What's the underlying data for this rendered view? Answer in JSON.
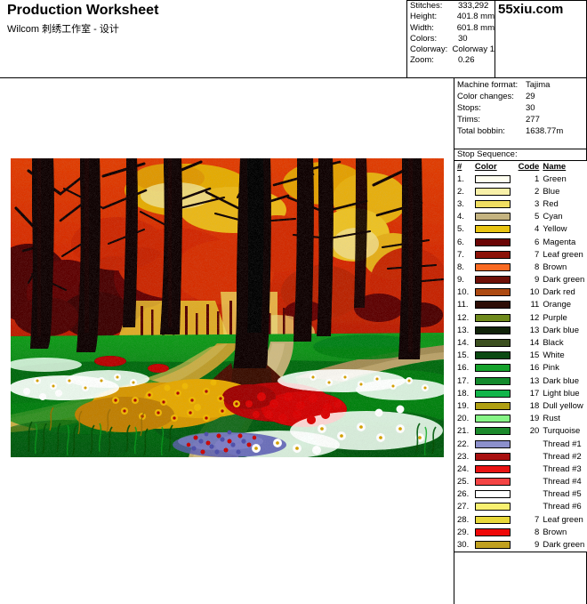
{
  "header": {
    "title": "Production Worksheet",
    "subtitle": "Wilcom 刺绣工作室 - 设计",
    "brand": "55xiu.com"
  },
  "summary": {
    "rows": [
      {
        "label": "Stitches:",
        "value": "333,292"
      },
      {
        "label": "Height:",
        "value": "401.8 mm"
      },
      {
        "label": "Width:",
        "value": "601.8 mm"
      },
      {
        "label": "Colors:",
        "value": "30"
      },
      {
        "label": "Colorway:",
        "value": "Colorway 1"
      },
      {
        "label": "Zoom:",
        "value": "0.26"
      }
    ]
  },
  "machine": {
    "rows": [
      {
        "label": "Machine format:",
        "value": "Tajima"
      },
      {
        "label": "Color changes:",
        "value": "29"
      },
      {
        "label": "Stops:",
        "value": "30"
      },
      {
        "label": "Trims:",
        "value": "277"
      },
      {
        "label": "Total bobbin:",
        "value": "1638.77m"
      }
    ]
  },
  "stop_sequence": {
    "caption": "Stop Sequence:",
    "columns": {
      "num": "#",
      "color": "Color",
      "code": "Code",
      "name": "Name"
    },
    "rows": [
      {
        "num": "1.",
        "swatch": "#fffff0",
        "code": "1",
        "name": "Green"
      },
      {
        "num": "2.",
        "swatch": "#f8f0a8",
        "code": "2",
        "name": "Blue"
      },
      {
        "num": "3.",
        "swatch": "#f0de62",
        "code": "3",
        "name": "Red"
      },
      {
        "num": "4.",
        "swatch": "#c4b380",
        "code": "5",
        "name": "Cyan"
      },
      {
        "num": "5.",
        "swatch": "#e8c413",
        "code": "4",
        "name": "Yellow"
      },
      {
        "num": "6.",
        "swatch": "#6b0505",
        "code": "6",
        "name": "Magenta"
      },
      {
        "num": "7.",
        "swatch": "#8c1208",
        "code": "7",
        "name": "Leaf green"
      },
      {
        "num": "8.",
        "swatch": "#f96a22",
        "code": "8",
        "name": "Brown"
      },
      {
        "num": "9.",
        "swatch": "#6e1008",
        "code": "9",
        "name": "Dark green"
      },
      {
        "num": "10.",
        "swatch": "#ad4a12",
        "code": "10",
        "name": "Dark red"
      },
      {
        "num": "11.",
        "swatch": "#2e0d06",
        "code": "11",
        "name": "Orange"
      },
      {
        "num": "12.",
        "swatch": "#6f8a1c",
        "code": "12",
        "name": "Purple"
      },
      {
        "num": "13.",
        "swatch": "#11240a",
        "code": "13",
        "name": "Dark blue"
      },
      {
        "num": "14.",
        "swatch": "#3c5020",
        "code": "14",
        "name": "Black"
      },
      {
        "num": "15.",
        "swatch": "#0b4a12",
        "code": "15",
        "name": "White"
      },
      {
        "num": "16.",
        "swatch": "#15a22c",
        "code": "16",
        "name": "Pink"
      },
      {
        "num": "17.",
        "swatch": "#138a2c",
        "code": "13",
        "name": "Dark blue"
      },
      {
        "num": "18.",
        "swatch": "#12b54a",
        "code": "17",
        "name": "Light blue"
      },
      {
        "num": "19.",
        "swatch": "#b0a012",
        "code": "18",
        "name": "Dull yellow"
      },
      {
        "num": "20.",
        "swatch": "#86f486",
        "code": "19",
        "name": "Rust"
      },
      {
        "num": "21.",
        "swatch": "#1c8a2c",
        "code": "20",
        "name": "Turquoise"
      },
      {
        "num": "22.",
        "swatch": "#8c90cc",
        "code": "",
        "name": "Thread #1"
      },
      {
        "num": "23.",
        "swatch": "#a81010",
        "code": "",
        "name": "Thread #2"
      },
      {
        "num": "24.",
        "swatch": "#e81212",
        "code": "",
        "name": "Thread #3"
      },
      {
        "num": "25.",
        "swatch": "#f44444",
        "code": "",
        "name": "Thread #4"
      },
      {
        "num": "26.",
        "swatch": "#ffffff",
        "code": "",
        "name": "Thread #5"
      },
      {
        "num": "27.",
        "swatch": "#f8f070",
        "code": "",
        "name": "Thread #6"
      },
      {
        "num": "28.",
        "swatch": "#e8d83a",
        "code": "7",
        "name": "Leaf green"
      },
      {
        "num": "29.",
        "swatch": "#ef0808",
        "code": "8",
        "name": "Brown"
      },
      {
        "num": "30.",
        "swatch": "#c0a020",
        "code": "9",
        "name": "Dark green"
      }
    ]
  },
  "artwork": {
    "alt": "Embroidery design preview: autumn forest with winding path and flower beds",
    "palette": {
      "sky_orange": "#ef7f2a",
      "foliage_orange": "#e86b18",
      "foliage_yellow": "#f0d23a",
      "foliage_red": "#9e1c14",
      "trunk_dark": "#3d2018",
      "trunk_mid": "#5c2d1c",
      "grass_light": "#56cf63",
      "grass_mid": "#2faa44",
      "grass_dark": "#1d6e2c",
      "path_sand": "#ddd2ab",
      "path_gold": "#d8b23c",
      "flower_white": "#ffffff",
      "flower_yellow": "#f2cf22",
      "flower_red": "#e01f12",
      "flower_violet": "#9a9bd6"
    }
  }
}
